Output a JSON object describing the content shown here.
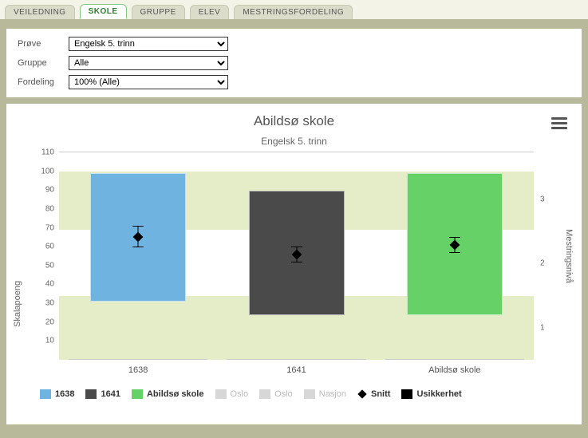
{
  "tabs": {
    "items": [
      "VEILEDNING",
      "SKOLE",
      "GRUPPE",
      "ELEV",
      "MESTRINGSFORDELING"
    ],
    "active_index": 1
  },
  "filters": {
    "prove": {
      "label": "Prøve",
      "value": "Engelsk 5. trinn"
    },
    "gruppe": {
      "label": "Gruppe",
      "value": "Alle"
    },
    "fordeling": {
      "label": "Fordeling",
      "value": "100% (Alle)"
    }
  },
  "chart_data": {
    "type": "bar",
    "title": "Abildsø skole",
    "subtitle": "Engelsk 5. trinn",
    "xlabel": "",
    "ylabel_left": "Skalapoeng",
    "ylabel_right": "Mestringsnivå",
    "ylim": [
      0,
      110
    ],
    "yticks_left": [
      10,
      20,
      30,
      40,
      50,
      60,
      70,
      80,
      90,
      100,
      110
    ],
    "yticks_right": [
      {
        "label": "1",
        "y": 17
      },
      {
        "label": "2",
        "y": 51
      },
      {
        "label": "3",
        "y": 85
      }
    ],
    "bands": [
      {
        "from": 0,
        "to": 34,
        "color": "#e4edc8"
      },
      {
        "from": 69,
        "to": 100,
        "color": "#e4edc8"
      }
    ],
    "categories": [
      "1638",
      "1641",
      "Abildsø skole"
    ],
    "series": [
      {
        "name": "range",
        "type": "columnrange",
        "data": [
          {
            "low": 30,
            "high": 98,
            "color": "#6fb3e0"
          },
          {
            "low": 23,
            "high": 89,
            "color": "#4a4a4a"
          },
          {
            "low": 23,
            "high": 98,
            "color": "#66d166"
          }
        ]
      },
      {
        "name": "Snitt",
        "type": "scatter",
        "data": [
          65,
          56,
          61
        ]
      },
      {
        "name": "Usikkerhet",
        "type": "errorbar",
        "data": [
          {
            "low": 60,
            "high": 71
          },
          {
            "low": 52,
            "high": 60
          },
          {
            "low": 57,
            "high": 65
          }
        ]
      }
    ]
  },
  "legend": {
    "items": [
      {
        "label": "1638",
        "color": "#6fb3e0",
        "bold": true
      },
      {
        "label": "1641",
        "color": "#4a4a4a",
        "bold": true
      },
      {
        "label": "Abildsø skole",
        "color": "#66d166",
        "bold": true
      },
      {
        "label": "Oslo",
        "color": "#d7d7d7",
        "dim": true
      },
      {
        "label": "Oslo",
        "color": "#d7d7d7",
        "dim": true
      },
      {
        "label": "Nasjon",
        "color": "#d7d7d7",
        "dim": true
      },
      {
        "label": "Snitt",
        "shape": "diamond",
        "bold": true
      },
      {
        "label": "Usikkerhet",
        "color": "#000000",
        "bold": true
      }
    ]
  },
  "icons": {
    "menu": "menu-icon"
  }
}
